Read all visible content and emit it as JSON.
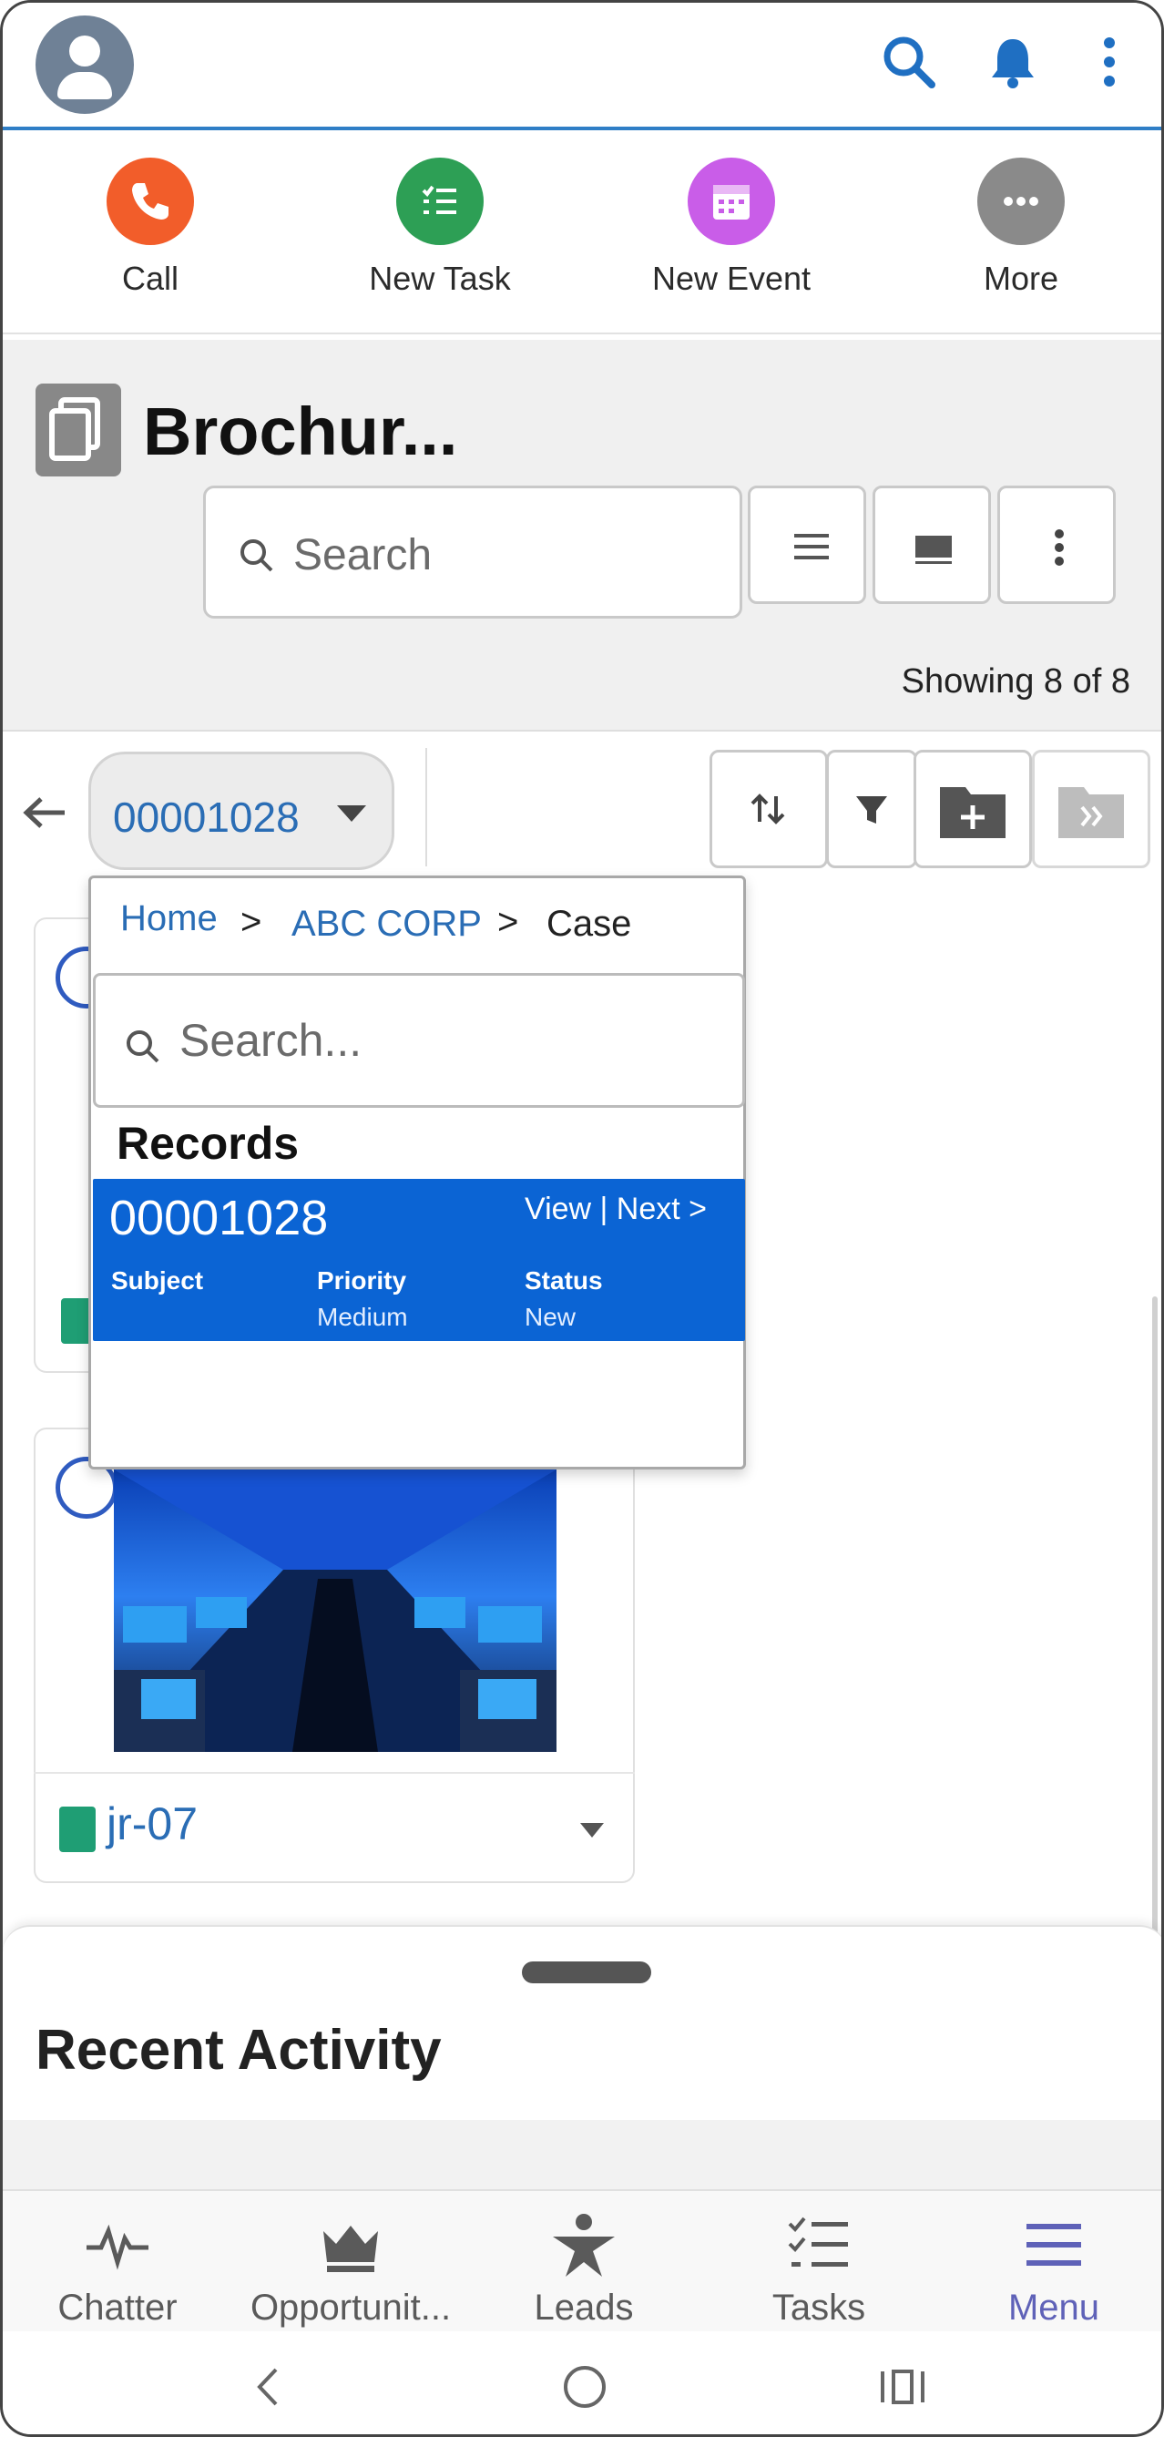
{
  "actions": [
    {
      "label": "Call",
      "color": "#f25d2a",
      "icon": "phone-icon"
    },
    {
      "label": "New Task",
      "color": "#2d9f55",
      "icon": "task-list-icon"
    },
    {
      "label": "New Event",
      "color": "#c95de8",
      "icon": "calendar-icon"
    },
    {
      "label": "More",
      "color": "#8a8a8a",
      "icon": "more-horizontal-icon"
    }
  ],
  "object": {
    "title": "Brochur...",
    "search_placeholder": "Search",
    "showing": "Showing 8 of 8"
  },
  "filter": {
    "case_number": "00001028"
  },
  "popover": {
    "breadcrumb": {
      "home": "Home",
      "account": "ABC CORP",
      "current": "Case",
      "separator": ">"
    },
    "search_placeholder": "Search...",
    "section_title": "Records",
    "record": {
      "number": "00001028",
      "links": "View | Next >",
      "subject_label": "Subject",
      "subject_value": "",
      "priority_label": "Priority",
      "priority_value": "Medium",
      "status_label": "Status",
      "status_value": "New"
    }
  },
  "cards": [
    {
      "name": "jr-07"
    }
  ],
  "recent_activity": {
    "title": "Recent Activity"
  },
  "bottom_nav": [
    {
      "label": "Chatter",
      "icon": "pulse-icon"
    },
    {
      "label": "Opportunit...",
      "icon": "crown-icon"
    },
    {
      "label": "Leads",
      "icon": "star-person-icon"
    },
    {
      "label": "Tasks",
      "icon": "checklist-icon"
    },
    {
      "label": "Menu",
      "icon": "menu-icon",
      "active": true
    }
  ],
  "colors": {
    "brand_blue": "#2f7ec6",
    "link_blue": "#2a6db5",
    "record_highlight": "#0b64d4",
    "menu_active": "#5f62b8"
  }
}
